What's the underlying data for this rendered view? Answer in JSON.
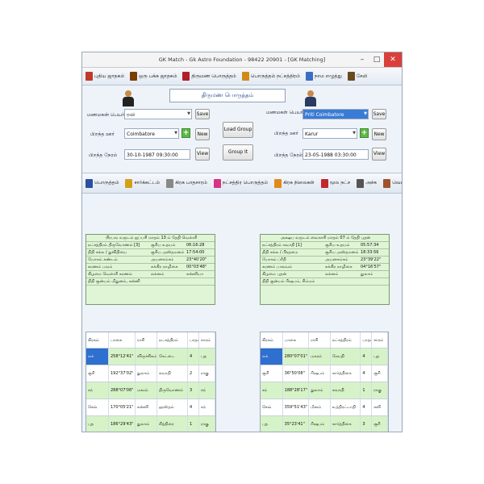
{
  "window": {
    "title": "GK Match - Gk Astro Foundation - 98422 20901 - [GK Matching]",
    "minimize": "–",
    "maximize": "□",
    "close": "✕"
  },
  "menu": [
    {
      "label": "புதிய ஜாதகம்",
      "icon": "new-horoscope-icon",
      "color": "#c0392b"
    },
    {
      "label": "ஒரு பக்க ஜாதகம்",
      "icon": "single-page-icon",
      "color": "#7b3f00"
    },
    {
      "label": "திருமண பொருத்தம்",
      "icon": "marriage-match-icon",
      "color": "#b0202a"
    },
    {
      "label": "பொருத்தம் நட்சத்திரம்",
      "icon": "star-match-icon",
      "color": "#d08a1a"
    },
    {
      "label": "நாம எழுத்து",
      "icon": "name-letter-icon",
      "color": "#3a6fc4"
    },
    {
      "label": "சேமி",
      "icon": "save-icon",
      "color": "#6b4a1e"
    }
  ],
  "form": {
    "title": "திருமண பொருத்தம்",
    "male": {
      "name_label": "மணமகன் பெயர்",
      "name_value": "ரவி",
      "place_label": "பிறந்த ஊர்",
      "place_value": "Coimbatore",
      "dob_label": "பிறந்த நேரம்",
      "dob_value": "30-10-1987 09:30:00",
      "save": "Save",
      "new": "New",
      "view": "View"
    },
    "female": {
      "name_label": "மணமகள் பெயர்",
      "name_value": "Priti Coimbatore",
      "place_label": "பிறந்த ஊர்",
      "place_value": "Karur",
      "dob_label": "பிறந்த நேரம்",
      "dob_value": "23-05-1988 03:30:00",
      "save": "Save",
      "new": "New",
      "view": "View"
    },
    "load_group": "Load Group",
    "group_it": "Group It"
  },
  "toolbar2": [
    {
      "label": "பொருத்தம்",
      "icon": "match-icon",
      "color": "#2a4fa0"
    },
    {
      "label": "சார்க்கட்டம்",
      "icon": "chart-grid-icon",
      "color": "#d4a017"
    },
    {
      "label": "கிரக பாதசாரம்",
      "icon": "planet-position-icon",
      "color": "#888888"
    },
    {
      "label": "நட்சத்திர பொருத்தம்",
      "icon": "star-icon",
      "color": "#d63384"
    },
    {
      "label": "கிரக நிலைகள்",
      "icon": "planet-status-icon",
      "color": "#e08a1a"
    },
    {
      "label": "மூல நட்ச",
      "icon": "cross-icon",
      "color": "#c0282d"
    },
    {
      "label": "அச்சு",
      "icon": "print-icon",
      "color": "#555555"
    },
    {
      "label": "வெளியே",
      "icon": "exit-icon",
      "color": "#a0522d"
    }
  ],
  "left_info": {
    "header": "பிரபவ வருடம் ஐப்பசி மாதம் 13 ம் தேதி வெள்ளி",
    "rows": [
      [
        "நட்சத்திரம் திருவோணம் [3]",
        "சூரிய உதயம்",
        "06:16:28"
      ],
      [
        "திதி சுக்ல / துவிதியை",
        "சூரிய அஸ்தமனம்",
        "17:54:00"
      ],
      [
        "யோகம் கண்டம்",
        "அயனாம்சம்",
        "23°40'20\""
      ],
      [
        "கரணம் பவம்",
        "சுக்கிர நாழிகை",
        "00°03'48\""
      ],
      [
        "கிழமை வெள்ளி கரணம்",
        "லக்னம்",
        "கன்னியா"
      ]
    ],
    "footer": "திதி சூன்யம் மிதுனம், கன்னி"
  },
  "right_info": {
    "header": "அக்ஷய வருடம் வைகாசி மாதம் 07 ம் தேதி புதன்",
    "rows": [
      [
        "நட்சத்திரம் சுவாதி [1]",
        "சூரிய உதயம்",
        "05:57:34"
      ],
      [
        "திதி சுக்ல / பிரதமை",
        "சூரிய அஸ்தமனம்",
        "18:33:56"
      ],
      [
        "யோகம் ப்ரீதி",
        "அயனாம்சம்",
        "23°39'22\""
      ],
      [
        "கரணம் பாலவம்",
        "சுக்கிர நாழிகை",
        "04°16'57\""
      ],
      [
        "கிழமை புதன்",
        "லக்னம்",
        "துலாம்"
      ]
    ],
    "footer": "திதி சூன்யம் ரிஷபம், சிம்மம்"
  },
  "left_table": {
    "headers": [
      "கிரகம்",
      "பாகை",
      "ராசி",
      "நட்சத்திரம்",
      "பாதம்",
      "சாரம்"
    ],
    "rows": [
      [
        "லக்",
        "258°12'41\"",
        "விருச்சிகம்",
        "கேட்டை",
        "4",
        "புத"
      ],
      [
        "சூரி",
        "192°37'02\"",
        "துலாம்",
        "சுவாதி",
        "2",
        "ராகு"
      ],
      [
        "சந்",
        "288°07'06\"",
        "மகரம்",
        "திருவோணம்",
        "3",
        "சந்"
      ],
      [
        "செவ்",
        "170°05'21\"",
        "கன்னி",
        "ஹஸ்தம்",
        "4",
        "சந்"
      ],
      [
        "புத",
        "186°29'43\"",
        "துலாம்",
        "சித்திரை",
        "1",
        "ராகு"
      ]
    ]
  },
  "right_table": {
    "headers": [
      "கிரகம்",
      "பாகை",
      "ராசி",
      "நட்சத்திரம்",
      "பாதம்",
      "சாரம்"
    ],
    "rows": [
      [
        "லக்",
        "280°07'01\"",
        "மகரம்",
        "ரேவதி",
        "4",
        "புத"
      ],
      [
        "சூரி",
        "36°50'08\"",
        "ரிஷபம்",
        "கார்த்திகை",
        "4",
        "சூரி"
      ],
      [
        "சந்",
        "188°28'17\"",
        "துலாம்",
        "சுவாதி",
        "1",
        "ராகு"
      ],
      [
        "செவ்",
        "359°51'43\"",
        "மீனம்",
        "உத்திரட்டாதி",
        "4",
        "சனி"
      ],
      [
        "புத",
        "35°23'41\"",
        "ரிஷபம்",
        "கார்த்திகை",
        "3",
        "சூரி"
      ]
    ]
  }
}
